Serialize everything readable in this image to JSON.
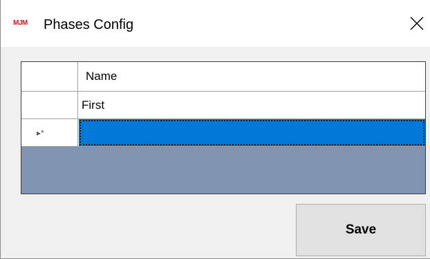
{
  "window": {
    "logo_text": "MJM",
    "title": "Phases Config",
    "close_glyph": "✕"
  },
  "grid": {
    "columns": [
      "Name"
    ],
    "rows": [
      {
        "name": "First",
        "indicator": "",
        "selected": false
      },
      {
        "name": "",
        "indicator": "▸*",
        "selected": true
      }
    ]
  },
  "actions": {
    "save_label": "Save"
  },
  "colors": {
    "selection": "#0078d7",
    "grid_background": "#8093b1",
    "logo": "#e0141e",
    "button_face": "#e1e1e1"
  }
}
